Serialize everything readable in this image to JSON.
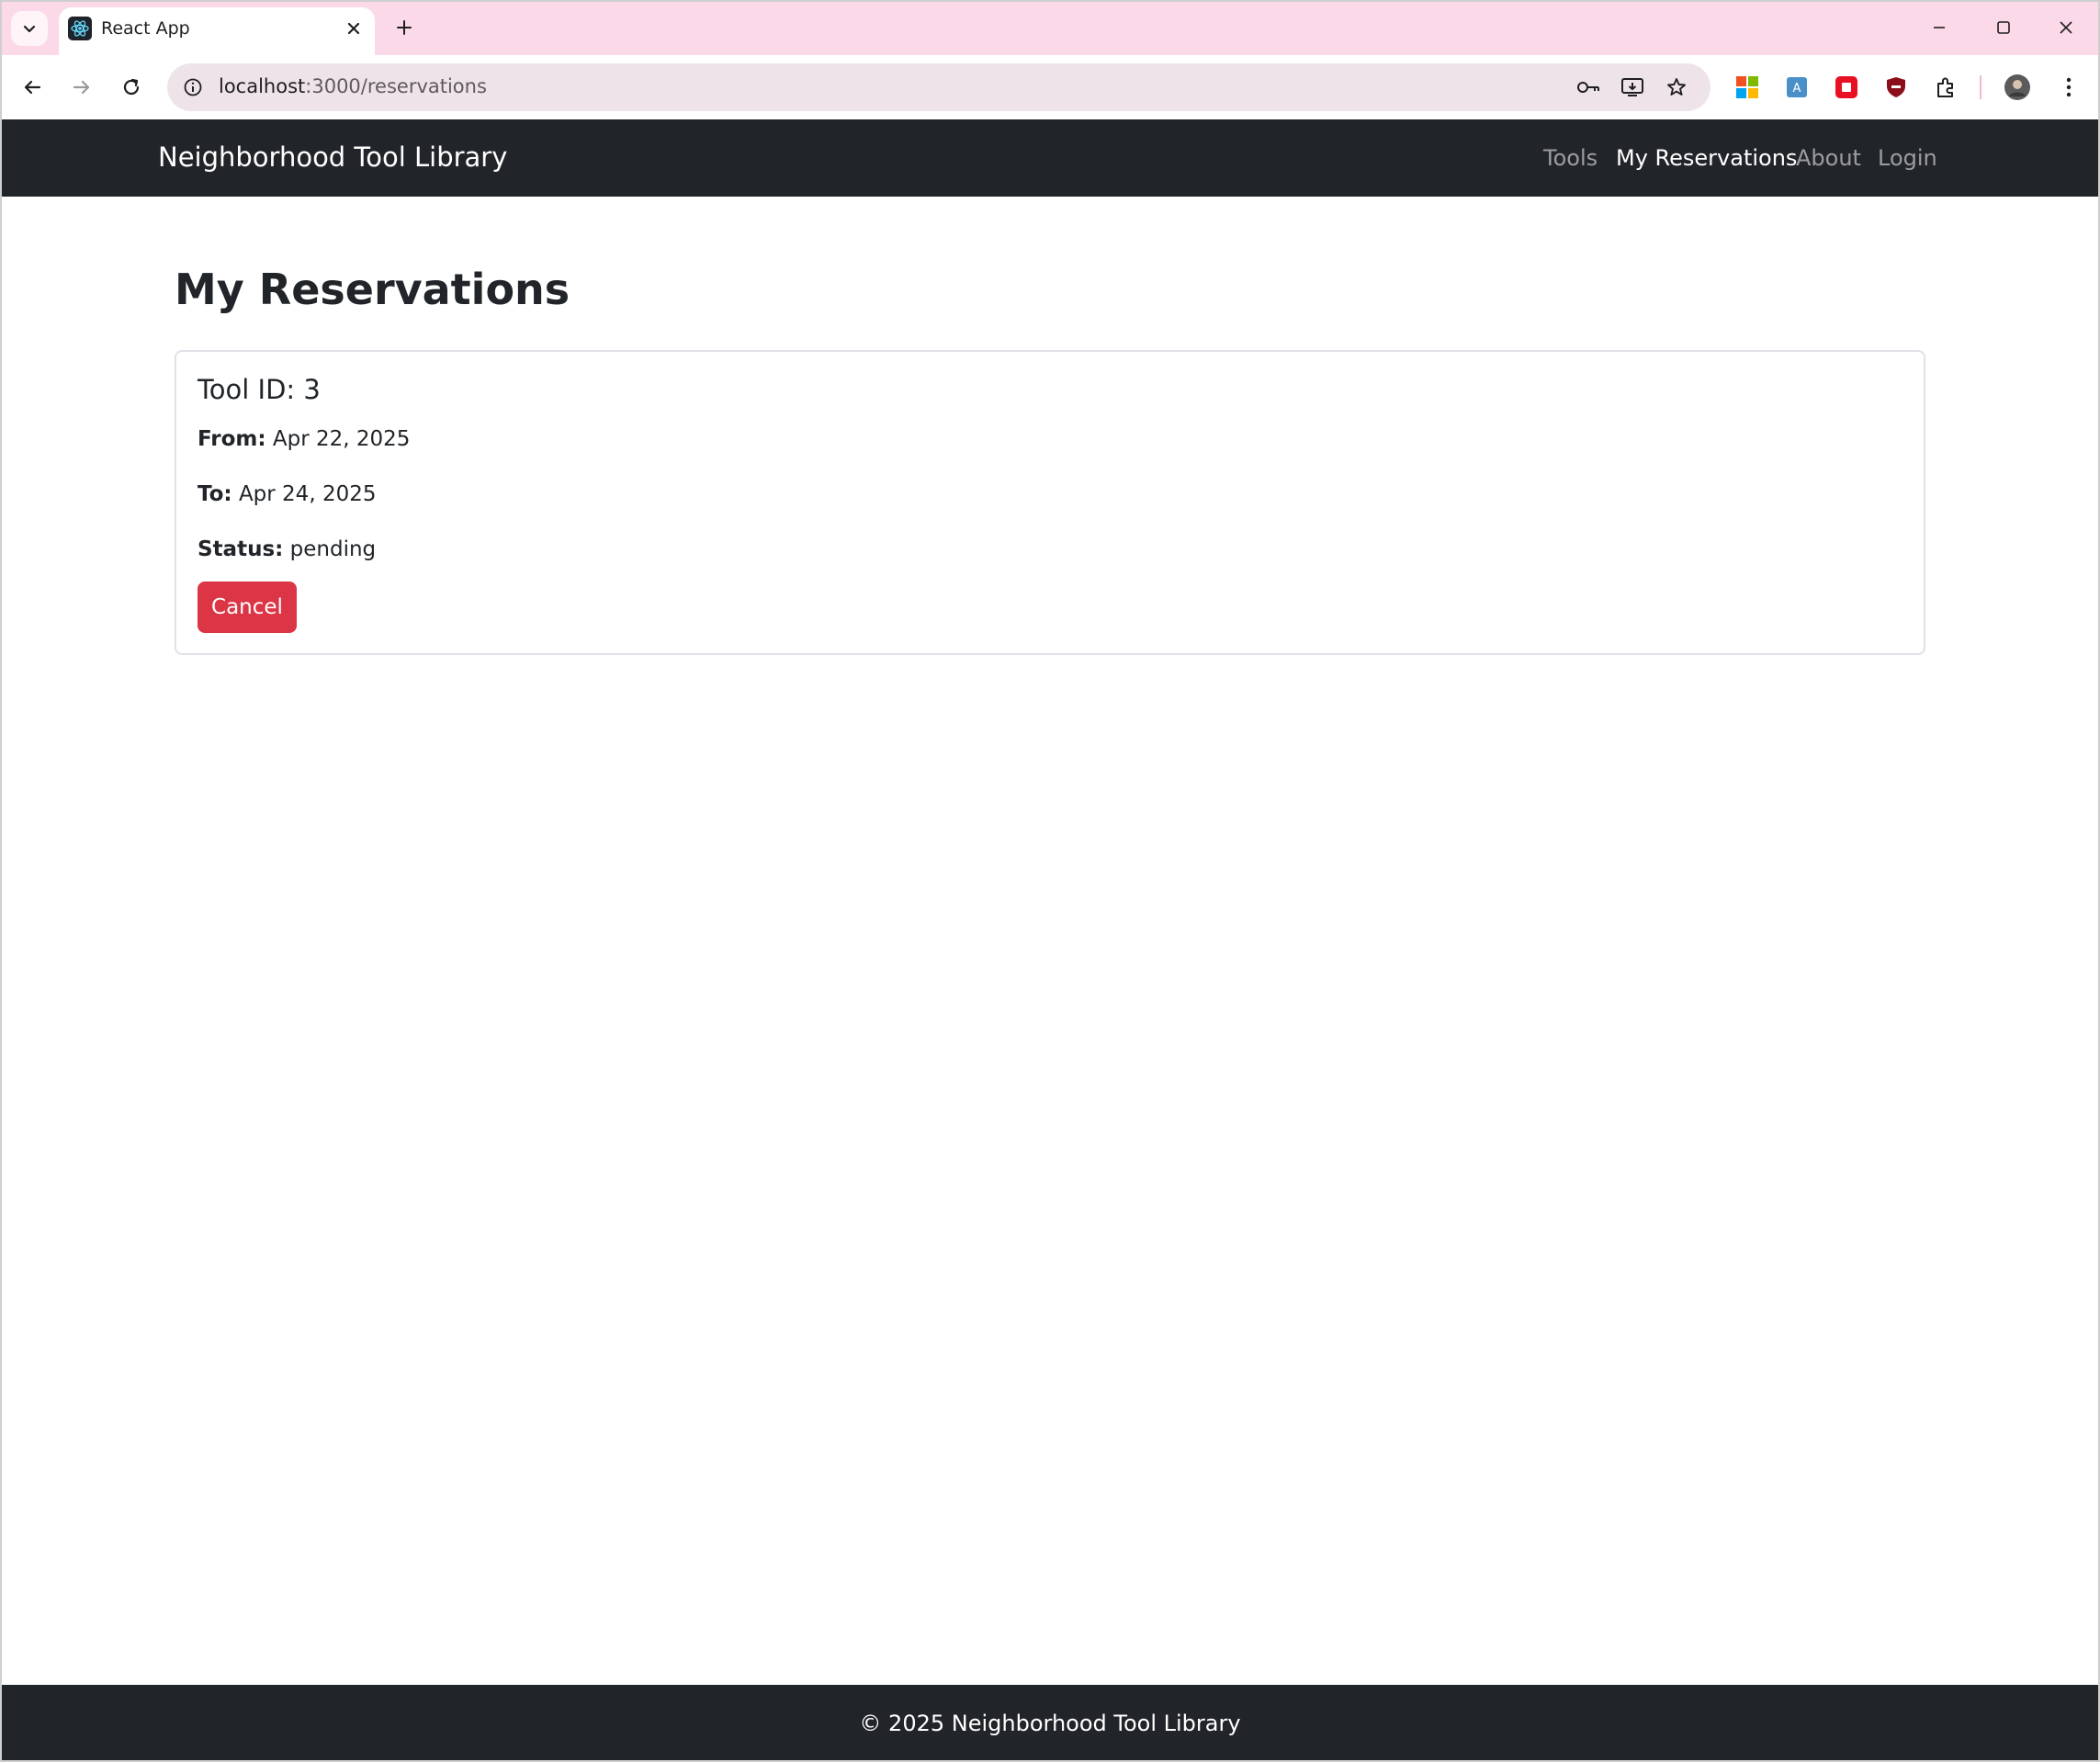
{
  "browser": {
    "tab_title": "React App",
    "url_host": "localhost",
    "url_rest": ":3000/reservations",
    "icons": [
      "tab-search-icon",
      "react-favicon-icon",
      "close-icon",
      "plus-icon",
      "minimize-icon",
      "maximize-icon",
      "window-close-icon",
      "back-icon",
      "forward-icon",
      "reload-icon",
      "site-info-icon",
      "password-key-icon",
      "install-app-icon",
      "bookmark-star-icon",
      "extension-icon",
      "profile-avatar-icon",
      "kebab-menu-icon"
    ]
  },
  "navbar": {
    "brand": "Neighborhood Tool Library",
    "links": [
      {
        "label": "Tools",
        "active": false
      },
      {
        "label": "My Reservations",
        "active": true
      },
      {
        "label": "About",
        "active": false
      },
      {
        "label": "Login",
        "active": false
      }
    ]
  },
  "page": {
    "title": "My Reservations"
  },
  "reservation": {
    "title": "Tool ID: 3",
    "from_label": "From:",
    "from_value": "Apr 22, 2025",
    "to_label": "To:",
    "to_value": "Apr 24, 2025",
    "status_label": "Status:",
    "status_value": "pending",
    "cancel_label": "Cancel"
  },
  "footer": {
    "text": "© 2025 Neighborhood Tool Library"
  },
  "colors": {
    "navbar_bg": "#212529",
    "danger": "#dc3545",
    "titlebar_bg": "#fbd9e8"
  }
}
